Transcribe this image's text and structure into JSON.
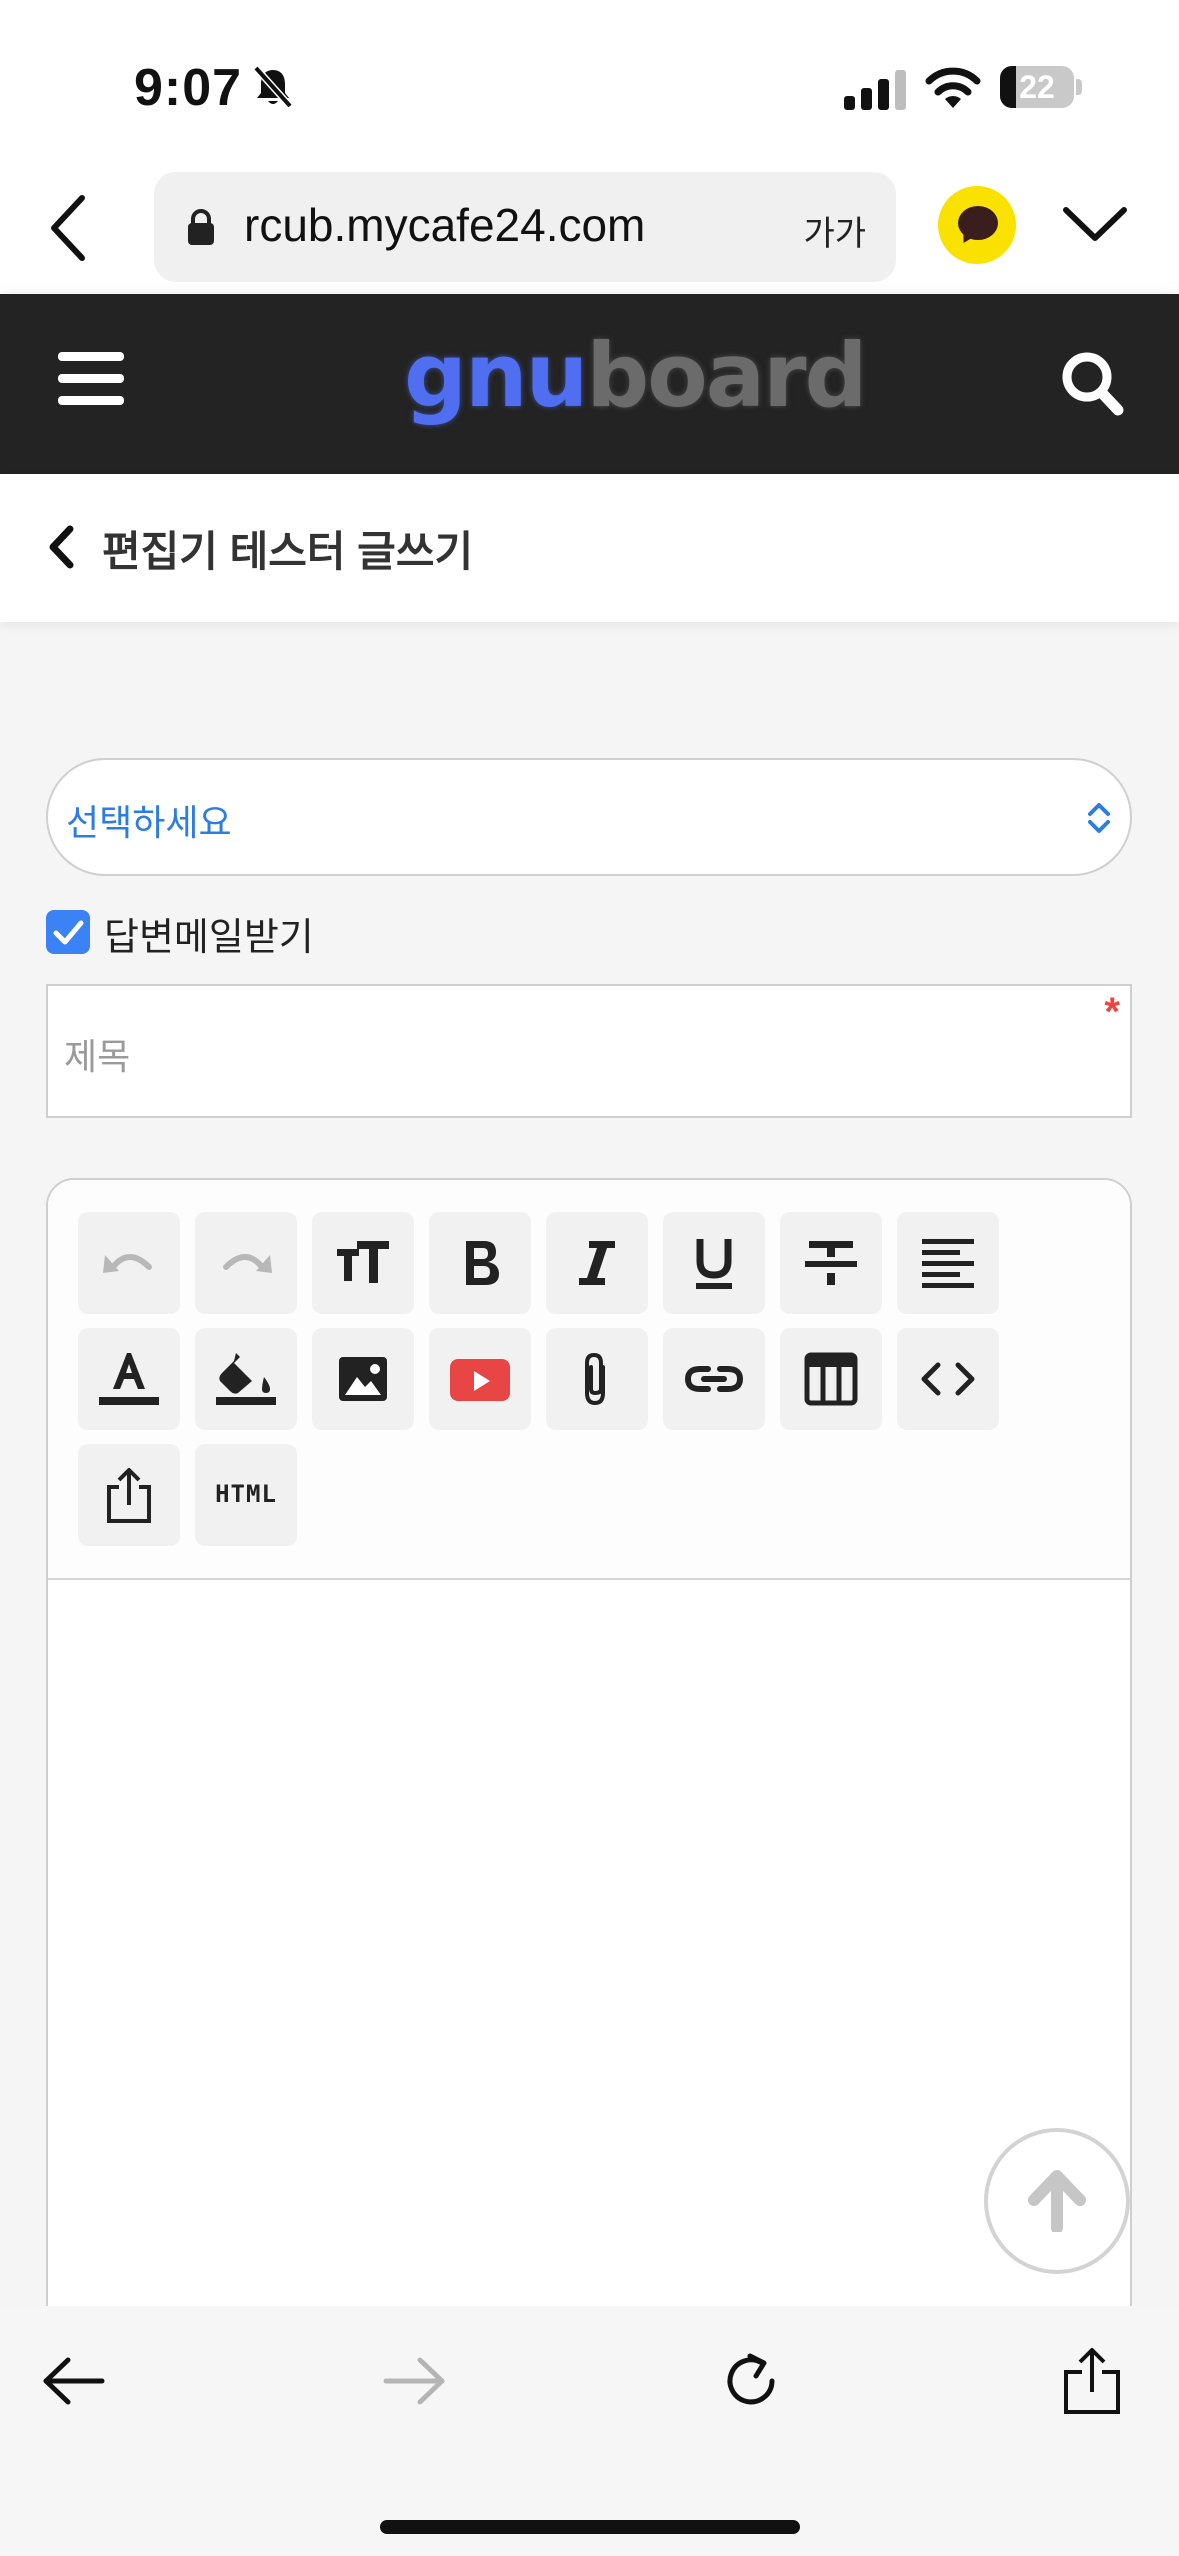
{
  "status_bar": {
    "time": "9:07",
    "battery_text": "22",
    "battery_percent": 22
  },
  "browser": {
    "url": "rcub.mycafe24.com",
    "text_size_label": "가가"
  },
  "site": {
    "logo_part1": "gnu",
    "logo_part2": "board",
    "logo_color_primary": "#4f6ef0",
    "logo_color_secondary": "#6b6b6b",
    "header_bg": "#232323"
  },
  "page": {
    "title": "편집기 테스터 글쓰기"
  },
  "form": {
    "category_select_value": "선택하세요",
    "reply_mail_label": "답변메일받기",
    "reply_mail_checked": true,
    "subject_placeholder": "제목",
    "required_mark": "*"
  },
  "editor_toolbar": {
    "buttons": [
      {
        "icon": "undo-icon",
        "enabled": false
      },
      {
        "icon": "redo-icon",
        "enabled": false
      },
      {
        "icon": "font-size-icon",
        "enabled": true
      },
      {
        "icon": "bold-icon",
        "enabled": true
      },
      {
        "icon": "italic-icon",
        "enabled": true
      },
      {
        "icon": "underline-icon",
        "enabled": true
      },
      {
        "icon": "strikethrough-icon",
        "enabled": true
      },
      {
        "icon": "align-left-icon",
        "enabled": true
      },
      {
        "icon": "text-color-icon",
        "enabled": true
      },
      {
        "icon": "background-color-icon",
        "enabled": true
      },
      {
        "icon": "image-icon",
        "enabled": true
      },
      {
        "icon": "youtube-icon",
        "enabled": true
      },
      {
        "icon": "attachment-icon",
        "enabled": true
      },
      {
        "icon": "link-icon",
        "enabled": true
      },
      {
        "icon": "table-icon",
        "enabled": true
      },
      {
        "icon": "code-icon",
        "enabled": true
      },
      {
        "icon": "export-icon",
        "enabled": true
      },
      {
        "icon": "html-icon",
        "enabled": true
      }
    ],
    "html_label": "HTML"
  },
  "colors": {
    "accent_blue": "#2b7de1",
    "checkbox_blue": "#3b82f6",
    "required_red": "#ef4444",
    "youtube_red": "#e84545",
    "kakao_yellow": "#fae100"
  }
}
